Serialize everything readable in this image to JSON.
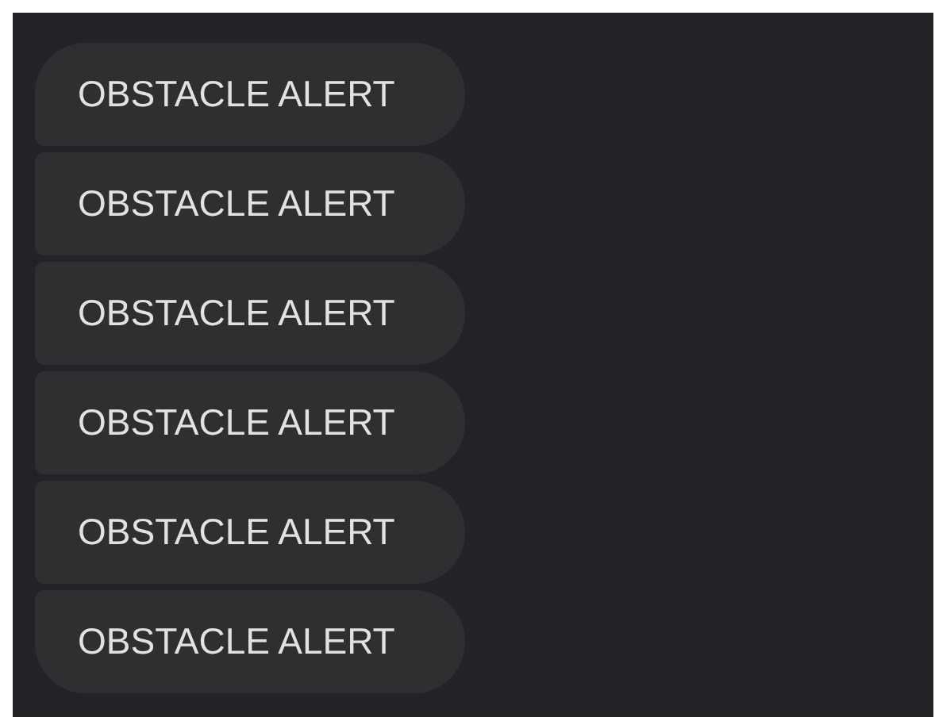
{
  "messages": [
    {
      "text": "OBSTACLE ALERT"
    },
    {
      "text": "OBSTACLE ALERT"
    },
    {
      "text": "OBSTACLE ALERT"
    },
    {
      "text": "OBSTACLE ALERT"
    },
    {
      "text": "OBSTACLE ALERT"
    },
    {
      "text": "OBSTACLE ALERT"
    }
  ]
}
